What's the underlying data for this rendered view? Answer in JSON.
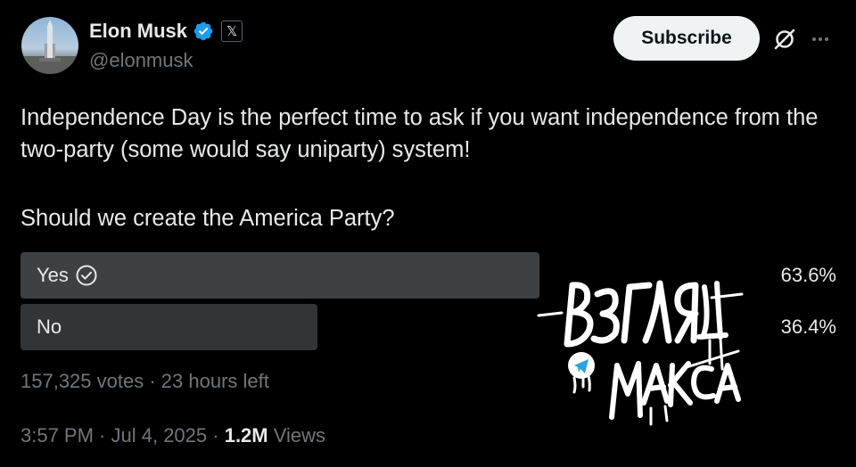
{
  "author": {
    "name": "Elon Musk",
    "handle": "@elonmusk",
    "verified_color": "#1d9bf0"
  },
  "header": {
    "subscribe_label": "Subscribe",
    "affiliate_badge": "𝕏"
  },
  "tweet": {
    "text": "Independence Day is the perfect time to ask if you want independence from the two-party (some would say uniparty) system!",
    "question": "Should we create the America Party?"
  },
  "poll": {
    "options": [
      {
        "label": "Yes",
        "percent": "63.6%",
        "value": 63.6,
        "selected": true
      },
      {
        "label": "No",
        "percent": "36.4%",
        "value": 36.4,
        "selected": false
      }
    ],
    "votes": "157,325 votes",
    "time_left": "23 hours left",
    "separator": " · "
  },
  "meta": {
    "time": "3:57 PM",
    "date": "Jul 4, 2025",
    "views_count": "1.2M",
    "views_label": "Views",
    "separator": " · "
  },
  "watermark": {
    "line1": "ВЗГЛЯД",
    "line2": "МАКСА"
  },
  "icons": {
    "more": "more-icon",
    "grok": "grok-icon",
    "check": "check-circle-icon",
    "telegram": "telegram-icon"
  }
}
